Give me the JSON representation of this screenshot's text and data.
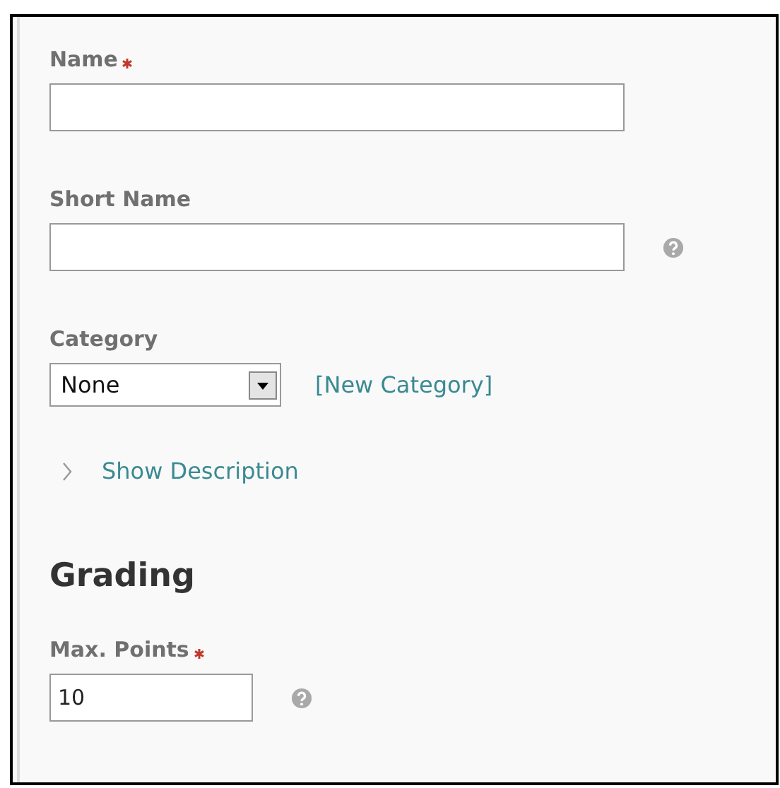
{
  "items": [
    {
      "kind": "text",
      "label": "Name",
      "required": true,
      "help": false
    },
    {
      "kind": "text",
      "label": "Short Name",
      "required": false,
      "help": true
    },
    {
      "kind": "select",
      "label": "Category",
      "required": false,
      "value": "None",
      "link": "[New Category]"
    },
    {
      "kind": "toggle",
      "label": "Show Description",
      "expanded": false
    },
    {
      "kind": "heading",
      "label": "Grading"
    },
    {
      "kind": "number",
      "label": "Max. Points",
      "required": true,
      "help": true,
      "value": "10"
    }
  ]
}
